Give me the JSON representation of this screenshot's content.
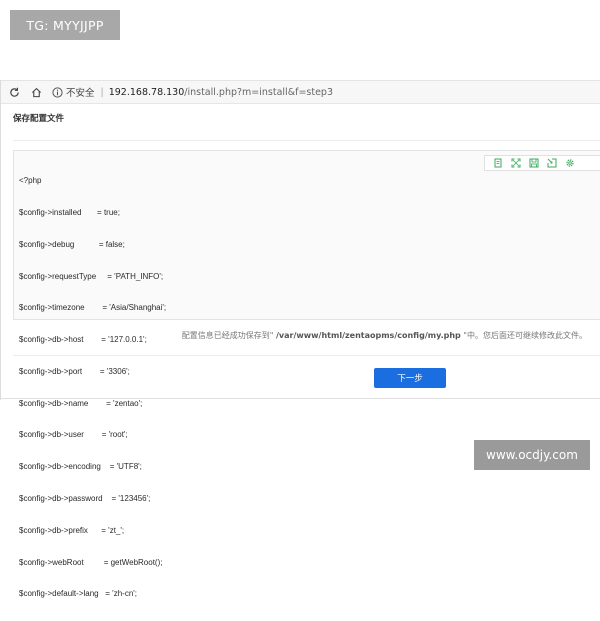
{
  "watermarks": {
    "top": "TG: MYYJJPP",
    "bottom": "www.ocdjy.com"
  },
  "addressbar": {
    "insecure_label": "不安全",
    "separator": "|",
    "url_host": "192.168.78.130",
    "url_path": "/install.php?m=install&f=step3"
  },
  "page": {
    "title": "保存配置文件"
  },
  "config_code": [
    "<?php",
    "$config->installed       = true;",
    "$config->debug           = false;",
    "$config->requestType     = 'PATH_INFO';",
    "$config->timezone        = 'Asia/Shanghai';",
    "$config->db->host        = '127.0.0.1';",
    "$config->db->port        = '3306';",
    "$config->db->name        = 'zentao';",
    "$config->db->user        = 'root';",
    "$config->db->encoding    = 'UTF8';",
    "$config->db->password    = '123456';",
    "$config->db->prefix      = 'zt_';",
    "$config->webRoot         = getWebRoot();",
    "$config->default->lang   = 'zh-cn';"
  ],
  "notice": {
    "prefix": "配置信息已经成功保存到\" ",
    "path": "/var/www/html/zentaopms/config/my.php",
    "suffix": " \"中。您后面还可继续修改此文件。"
  },
  "actions": {
    "next_label": "下一步"
  },
  "colors": {
    "primary": "#1a6ee0",
    "toolbar_icon": "#3aa85a"
  }
}
